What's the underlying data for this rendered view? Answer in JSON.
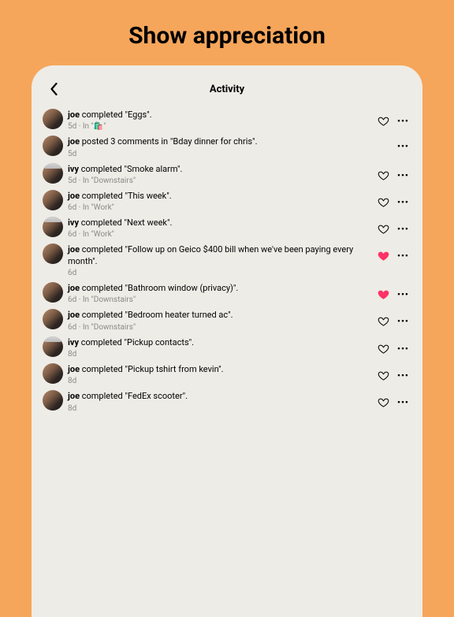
{
  "hero": {
    "title": "Show appreciation"
  },
  "screen": {
    "title": "Activity"
  },
  "feed": [
    {
      "user": "joe",
      "avatar": "joe",
      "text": " completed \"Eggs\".",
      "meta": "5d · In \"🛍️\"",
      "heart": "outline"
    },
    {
      "user": "joe",
      "avatar": "joe",
      "text": " posted 3 comments in \"Bday dinner for chris\".",
      "meta": "5d",
      "heart": "none"
    },
    {
      "user": "ivy",
      "avatar": "ivy",
      "text": "  completed \"Smoke alarm\".",
      "meta": "5d · In \"Downstairs\"",
      "heart": "outline"
    },
    {
      "user": "joe",
      "avatar": "joe",
      "text": " completed \"This week\".",
      "meta": "6d · In \"Work\"",
      "heart": "outline"
    },
    {
      "user": "ivy",
      "avatar": "ivy",
      "text": "  completed \"Next week\".",
      "meta": "6d · In \"Work\"",
      "heart": "outline"
    },
    {
      "user": "joe",
      "avatar": "joe",
      "text": " completed \"Follow up on Geico $400 bill when we've been paying every month\".",
      "meta": "6d",
      "heart": "filled"
    },
    {
      "user": "joe",
      "avatar": "joe",
      "text": " completed \"Bathroom window (privacy)\".",
      "meta": "6d · In \"Downstairs\"",
      "heart": "filled"
    },
    {
      "user": "joe",
      "avatar": "joe",
      "text": " completed \"Bedroom heater turned ac\".",
      "meta": "6d · In \"Downstairs\"",
      "heart": "outline"
    },
    {
      "user": "ivy",
      "avatar": "ivy",
      "text": "  completed \"Pickup contacts\".",
      "meta": "8d",
      "heart": "outline"
    },
    {
      "user": "joe",
      "avatar": "joe",
      "text": " completed \"Pickup tshirt from kevin\".",
      "meta": "8d",
      "heart": "outline"
    },
    {
      "user": "joe",
      "avatar": "joe",
      "text": " completed \"FedEx scooter\".",
      "meta": "8d",
      "heart": "outline"
    }
  ],
  "colors": {
    "heart_filled": "#ff3366"
  }
}
